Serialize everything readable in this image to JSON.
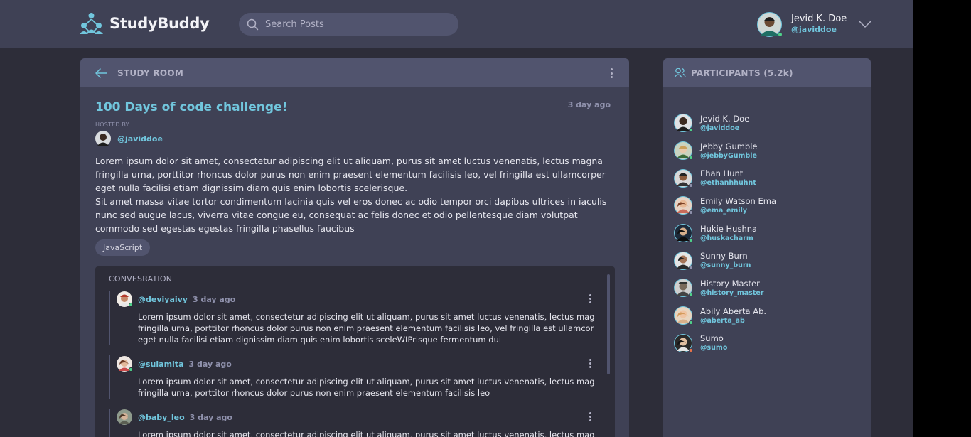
{
  "app": {
    "name": "StudyBuddy",
    "search_placeholder": "Search Posts"
  },
  "current_user": {
    "name": "Jevid K. Doe",
    "handle": "@javiddoe"
  },
  "room": {
    "header": "STUDY ROOM",
    "title": "100 Days of code challenge!",
    "time": "3 day ago",
    "hosted_by_label": "HOSTED BY",
    "host_handle": "@javiddoe",
    "description_1": "Lorem ipsum dolor sit amet, consectetur adipiscing elit ut aliquam, purus sit amet luctus venenatis, lectus magna fringilla urna, porttitor rhoncus dolor purus non enim praesent elementum facilisis leo, vel fringilla est ullamcorper eget nulla facilisi etiam dignissim diam quis enim lobortis scelerisque.",
    "description_2": "Sit amet massa vitae tortor condimentum lacinia quis vel eros donec ac odio tempor orci dapibus ultrices in iaculis nunc sed augue lacus, viverra vitae congue eu, consequat ac felis donec et odio pellentesque diam volutpat commodo sed egestas egestas fringilla phasellus faucibus",
    "topic": "JavaScript"
  },
  "conversation": {
    "title": "CONVESRATION",
    "messages": [
      {
        "handle": "@deviyaivy",
        "time": "3 day ago",
        "text": "Lorem ipsum dolor sit amet, consectetur adipiscing elit ut aliquam, purus sit amet luctus venenatis, lectus mag fringilla urna, porttitor rhoncus dolor purus non enim praesent elementum facilisis leo, vel fringilla est ullamcor eget nulla facilisi etiam dignissim diam quis enim lobortis sceleWIPrisque fermentum dui"
      },
      {
        "handle": "@sulamita",
        "time": "3 day ago",
        "text": "Lorem ipsum dolor sit amet, consectetur adipiscing elit ut aliquam, purus sit amet luctus venenatis, lectus mag fringilla urna, porttitor rhoncus dolor purus non enim praesent elementum facilisis leo"
      },
      {
        "handle": "@baby_leo",
        "time": "3 day ago",
        "text": "Lorem ipsum dolor sit amet, consectetur adipiscing elit ut aliquam, purus sit amet luctus venenatis, lectus mag"
      }
    ]
  },
  "participants": {
    "title": "PARTICIPANTS (5.2k)",
    "list": [
      {
        "name": "Jevid K. Doe",
        "handle": "@javiddoe",
        "status": "online"
      },
      {
        "name": "Jebby Gumble",
        "handle": "@jebbyGumble",
        "status": "online"
      },
      {
        "name": "Ehan Hunt",
        "handle": "@ethanhhuhnt",
        "status": "offline"
      },
      {
        "name": "Emily Watson Ema",
        "handle": "@ema_emily",
        "status": "offline"
      },
      {
        "name": "Hukie Hushna",
        "handle": "@huskacharm",
        "status": "online"
      },
      {
        "name": "Sunny Burn",
        "handle": "@sunny_burn",
        "status": "offline"
      },
      {
        "name": "History Master",
        "handle": "@history_master",
        "status": "online"
      },
      {
        "name": "Abily Aberta Ab.",
        "handle": "@aberta_ab",
        "status": "online"
      },
      {
        "name": "Sumo",
        "handle": "@sumo",
        "status": "busy"
      }
    ]
  },
  "colors": {
    "accent": "#71c6dd",
    "online": "#4fd28a",
    "offline": "#8f91ac",
    "busy": "#e8734a"
  }
}
